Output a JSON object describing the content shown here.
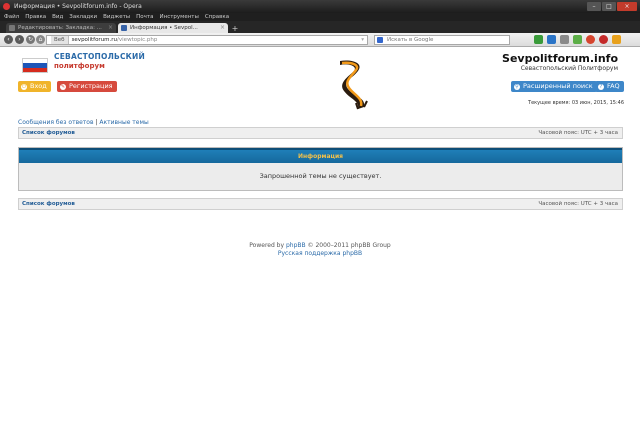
{
  "window": {
    "title": "Информация • Sevpolitforum.info - Opera",
    "controls": [
      "–",
      "□",
      "×"
    ]
  },
  "menu": [
    "Файл",
    "Правка",
    "Вид",
    "Закладки",
    "Виджеты",
    "Почта",
    "Инструменты",
    "Справка"
  ],
  "tabs": [
    {
      "label": "Редактировать: Закладка: ...",
      "active": false
    },
    {
      "label": "Информация • Sevpol...",
      "active": true
    }
  ],
  "address": {
    "badge": "Веб",
    "host": "sevpolitforum.ru",
    "path": "/viewtopic.php",
    "search_placeholder": "Искать в Google"
  },
  "header": {
    "logo_line1": "СЕВАСТОПОЛЬСКИЙ",
    "logo_line2": "политфорум",
    "site_title": "Sevpolitforum.info",
    "site_subtitle": "Севастопольский Политфорум"
  },
  "buttons": {
    "login": "Вход",
    "register": "Регистрация",
    "advanced_search": "Расширенный поиск",
    "faq": "FAQ"
  },
  "current_time": "Текущее время: 03 июн, 2015, 15:46",
  "links": {
    "unanswered": "Сообщения без ответов",
    "separator": "|",
    "active": "Активные темы"
  },
  "forum_bar": {
    "forum_list": "Список форумов",
    "timezone": "Часовой пояс: UTC + 3 часа"
  },
  "info": {
    "heading": "Информация",
    "message": "Запрошенной темы не существует."
  },
  "footer": {
    "powered_prefix": "Powered by",
    "phpbb": "phpBB",
    "powered_suffix": "© 2000–2011 phpBB Group",
    "russian_support": "Русская поддержка phpBB"
  },
  "colors": {
    "accent_blue": "#3e87c9",
    "login_orange": "#f0b42a",
    "register_red": "#d64a3d",
    "info_header": "#1f7fb8",
    "info_heading_text": "#f3c14a"
  }
}
